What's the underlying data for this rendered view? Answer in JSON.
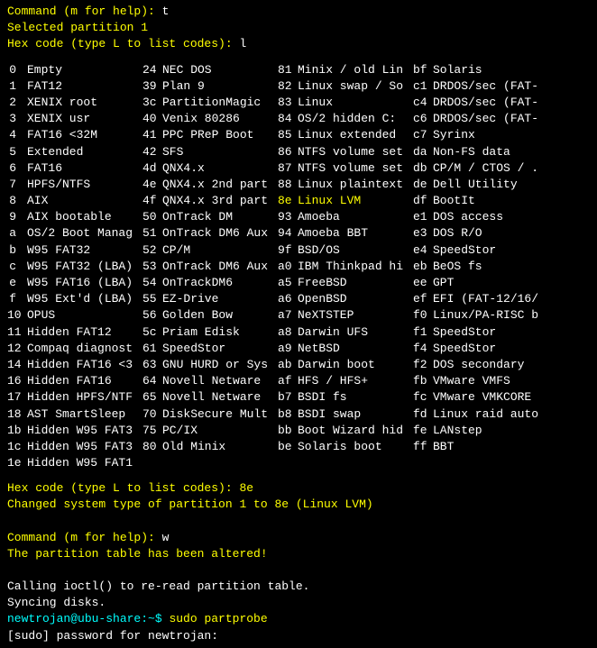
{
  "prompt1": "Command (m for help): ",
  "cmd1": "t",
  "selected": "Selected partition 1",
  "hexPrompt": "Hex code (type L to list codes): ",
  "hexCmd1": "l",
  "columns": [
    [
      {
        "c": "0",
        "n": "Empty"
      },
      {
        "c": "1",
        "n": "FAT12"
      },
      {
        "c": "2",
        "n": "XENIX root"
      },
      {
        "c": "3",
        "n": "XENIX usr"
      },
      {
        "c": "4",
        "n": "FAT16 <32M"
      },
      {
        "c": "5",
        "n": "Extended"
      },
      {
        "c": "6",
        "n": "FAT16"
      },
      {
        "c": "7",
        "n": "HPFS/NTFS"
      },
      {
        "c": "8",
        "n": "AIX"
      },
      {
        "c": "9",
        "n": "AIX bootable"
      },
      {
        "c": "a",
        "n": "OS/2 Boot Manag"
      },
      {
        "c": "b",
        "n": "W95 FAT32"
      },
      {
        "c": "c",
        "n": "W95 FAT32 (LBA)"
      },
      {
        "c": "e",
        "n": "W95 FAT16 (LBA)"
      },
      {
        "c": "f",
        "n": "W95 Ext'd (LBA)"
      },
      {
        "c": "10",
        "n": "OPUS"
      },
      {
        "c": "11",
        "n": "Hidden FAT12"
      },
      {
        "c": "12",
        "n": "Compaq diagnost"
      },
      {
        "c": "14",
        "n": "Hidden FAT16 <3"
      },
      {
        "c": "16",
        "n": "Hidden FAT16"
      },
      {
        "c": "17",
        "n": "Hidden HPFS/NTF"
      },
      {
        "c": "18",
        "n": "AST SmartSleep"
      },
      {
        "c": "1b",
        "n": "Hidden W95 FAT3"
      },
      {
        "c": "1c",
        "n": "Hidden W95 FAT3"
      },
      {
        "c": "1e",
        "n": "Hidden W95 FAT1"
      }
    ],
    [
      {
        "c": "24",
        "n": "NEC DOS"
      },
      {
        "c": "39",
        "n": "Plan 9"
      },
      {
        "c": "3c",
        "n": "PartitionMagic"
      },
      {
        "c": "40",
        "n": "Venix 80286"
      },
      {
        "c": "41",
        "n": "PPC PReP Boot"
      },
      {
        "c": "42",
        "n": "SFS"
      },
      {
        "c": "4d",
        "n": "QNX4.x"
      },
      {
        "c": "4e",
        "n": "QNX4.x 2nd part"
      },
      {
        "c": "4f",
        "n": "QNX4.x 3rd part"
      },
      {
        "c": "50",
        "n": "OnTrack DM"
      },
      {
        "c": "51",
        "n": "OnTrack DM6 Aux"
      },
      {
        "c": "52",
        "n": "CP/M"
      },
      {
        "c": "53",
        "n": "OnTrack DM6 Aux"
      },
      {
        "c": "54",
        "n": "OnTrackDM6"
      },
      {
        "c": "55",
        "n": "EZ-Drive"
      },
      {
        "c": "56",
        "n": "Golden Bow"
      },
      {
        "c": "5c",
        "n": "Priam Edisk"
      },
      {
        "c": "61",
        "n": "SpeedStor"
      },
      {
        "c": "63",
        "n": "GNU HURD or Sys"
      },
      {
        "c": "64",
        "n": "Novell Netware"
      },
      {
        "c": "65",
        "n": "Novell Netware"
      },
      {
        "c": "70",
        "n": "DiskSecure Mult"
      },
      {
        "c": "75",
        "n": "PC/IX"
      },
      {
        "c": "80",
        "n": "Old Minix"
      }
    ],
    [
      {
        "c": "81",
        "n": "Minix / old Lin"
      },
      {
        "c": "82",
        "n": "Linux swap / So"
      },
      {
        "c": "83",
        "n": "Linux"
      },
      {
        "c": "84",
        "n": "OS/2 hidden C:"
      },
      {
        "c": "85",
        "n": "Linux extended"
      },
      {
        "c": "86",
        "n": "NTFS volume set"
      },
      {
        "c": "87",
        "n": "NTFS volume set"
      },
      {
        "c": "88",
        "n": "Linux plaintext"
      },
      {
        "c": "8e",
        "n": "Linux LVM",
        "hl": true
      },
      {
        "c": "93",
        "n": "Amoeba"
      },
      {
        "c": "94",
        "n": "Amoeba BBT"
      },
      {
        "c": "9f",
        "n": "BSD/OS"
      },
      {
        "c": "a0",
        "n": "IBM Thinkpad hi"
      },
      {
        "c": "a5",
        "n": "FreeBSD"
      },
      {
        "c": "a6",
        "n": "OpenBSD"
      },
      {
        "c": "a7",
        "n": "NeXTSTEP"
      },
      {
        "c": "a8",
        "n": "Darwin UFS"
      },
      {
        "c": "a9",
        "n": "NetBSD"
      },
      {
        "c": "ab",
        "n": "Darwin boot"
      },
      {
        "c": "af",
        "n": "HFS / HFS+"
      },
      {
        "c": "b7",
        "n": "BSDI fs"
      },
      {
        "c": "b8",
        "n": "BSDI swap"
      },
      {
        "c": "bb",
        "n": "Boot Wizard hid"
      },
      {
        "c": "be",
        "n": "Solaris boot"
      }
    ],
    [
      {
        "c": "bf",
        "n": "Solaris"
      },
      {
        "c": "c1",
        "n": "DRDOS/sec (FAT-"
      },
      {
        "c": "c4",
        "n": "DRDOS/sec (FAT-"
      },
      {
        "c": "c6",
        "n": "DRDOS/sec (FAT-"
      },
      {
        "c": "c7",
        "n": "Syrinx"
      },
      {
        "c": "da",
        "n": "Non-FS data"
      },
      {
        "c": "db",
        "n": "CP/M / CTOS / ."
      },
      {
        "c": "de",
        "n": "Dell Utility"
      },
      {
        "c": "df",
        "n": "BootIt"
      },
      {
        "c": "e1",
        "n": "DOS access"
      },
      {
        "c": "e3",
        "n": "DOS R/O"
      },
      {
        "c": "e4",
        "n": "SpeedStor"
      },
      {
        "c": "eb",
        "n": "BeOS fs"
      },
      {
        "c": "ee",
        "n": "GPT"
      },
      {
        "c": "ef",
        "n": "EFI (FAT-12/16/"
      },
      {
        "c": "f0",
        "n": "Linux/PA-RISC b"
      },
      {
        "c": "f1",
        "n": "SpeedStor"
      },
      {
        "c": "f4",
        "n": "SpeedStor"
      },
      {
        "c": "f2",
        "n": "DOS secondary"
      },
      {
        "c": "fb",
        "n": "VMware VMFS"
      },
      {
        "c": "fc",
        "n": "VMware VMKCORE"
      },
      {
        "c": "fd",
        "n": "Linux raid auto"
      },
      {
        "c": "fe",
        "n": "LANstep"
      },
      {
        "c": "ff",
        "n": "BBT"
      }
    ]
  ],
  "hexCmd2": "8e",
  "changed": "Changed system type of partition 1 to 8e (Linux LVM)",
  "cmd2": "w",
  "altered": "The partition table has been altered!",
  "ioctl": "Calling ioctl() to re-read partition table.",
  "syncing": "Syncing disks.",
  "shellPrompt": "newtrojan@ubu-share:~$ ",
  "shellCmd": "sudo partprobe",
  "sudoPrompt": "[sudo] password for newtrojan:"
}
